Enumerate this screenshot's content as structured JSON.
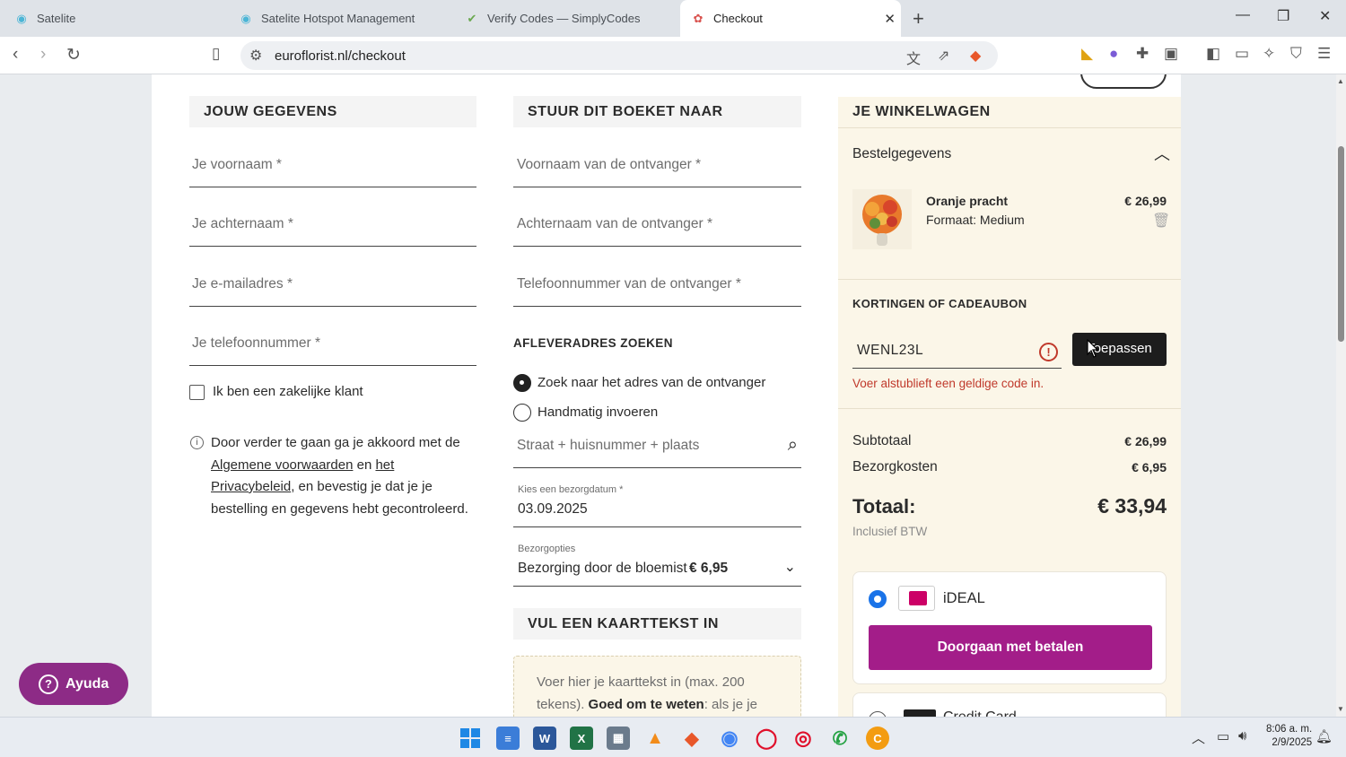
{
  "browser": {
    "tabs": [
      {
        "title": "Satelite"
      },
      {
        "title": "Satelite Hotspot Management"
      },
      {
        "title": "Verify Codes — SimplyCodes"
      },
      {
        "title": "Checkout"
      }
    ],
    "url": "euroflorist.nl/checkout"
  },
  "details": {
    "heading": "JOUW GEGEVENS",
    "first_name_ph": "Je voornaam *",
    "last_name_ph": "Je achternaam *",
    "email_ph": "Je e-mailadres *",
    "phone_ph": "Je telefoonnummer *",
    "business_label": "Ik ben een zakelijke klant",
    "terms_part1": "Door verder te gaan ga je akkoord met de",
    "terms_link1": "Algemene voorwaarden",
    "terms_en": "en",
    "terms_link2a": "het",
    "terms_link2b": "Privacybeleid",
    "terms_part2": ", en bevestig je dat je je",
    "terms_part3": "bestelling en gegevens hebt gecontroleerd."
  },
  "recipient": {
    "heading": "STUUR DIT BOEKET NAAR",
    "first_name_ph": "Voornaam van de ontvanger *",
    "last_name_ph": "Achternaam van de ontvanger *",
    "phone_ph": "Telefoonnummer van de ontvanger *",
    "address_heading": "AFLEVERADRES ZOEKEN",
    "radio_search": "Zoek naar het adres van de ontvanger",
    "radio_manual": "Handmatig invoeren",
    "address_ph": "Straat + huisnummer + plaats",
    "date_label": "Kies een bezorgdatum *",
    "date_value": "03.09.2025",
    "delivery_label": "Bezorgopties",
    "delivery_value": "Bezorging door de bloemist -",
    "delivery_price": "€ 6,95",
    "card_heading": "VUL EEN KAARTTEKST IN",
    "card_line1": "Voer hier je kaarttekst in (max. 200",
    "card_line2a": "tekens).",
    "card_line2b": "Goed om te weten",
    "card_line2c": ": als je je naam"
  },
  "cart": {
    "heading": "JE WINKELWAGEN",
    "order_details": "Bestelgegevens",
    "product_name": "Oranje pracht",
    "product_size": "Formaat: Medium",
    "product_price": "€ 26,99",
    "discount_heading": "KORTINGEN OF CADEAUBON",
    "code_value": "WENL23L",
    "apply_label": "Toepassen",
    "error": "Voer alstublieft een geldige code in.",
    "subtotal_label": "Subtotaal",
    "subtotal_value": "€ 26,99",
    "shipping_label": "Bezorgkosten",
    "shipping_value": "€ 6,95",
    "total_label": "Totaal:",
    "total_value": "€ 33,94",
    "vat_note": "Inclusief BTW",
    "payment_ideal": "iDEAL",
    "pay_button": "Doorgaan met betalen",
    "payment_credit": "Credit Card"
  },
  "help": {
    "label": "Ayuda"
  },
  "taskbar": {
    "time": "8:06 a. m.",
    "date": "2/9/2025"
  },
  "colors": {
    "accent": "#a31d89",
    "error": "#c0392b",
    "cart_bg": "#fbf6e8"
  }
}
